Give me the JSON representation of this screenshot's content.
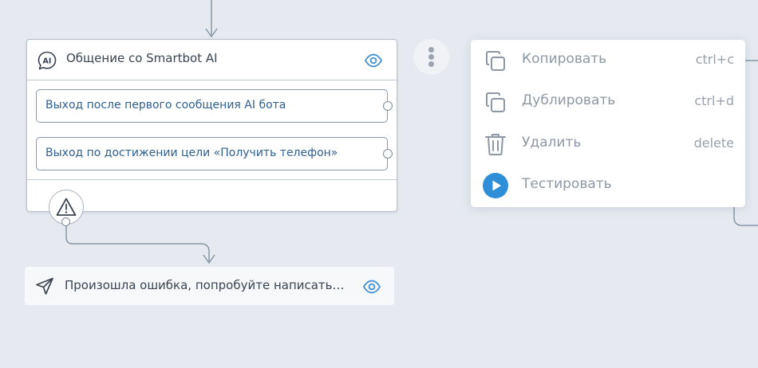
{
  "ai_node": {
    "title": "Общение со Smartbot AI",
    "icon": "ai-chat-icon",
    "exits": [
      {
        "label": "Выход после первого сообщения AI бота"
      },
      {
        "label": "Выход по достижении цели «Получить телефон»"
      }
    ]
  },
  "message_node": {
    "title": "Произошла ошибка, попробуйте написать…",
    "icon": "send-icon"
  },
  "context_menu": {
    "items": [
      {
        "label": "Копировать",
        "shortcut": "ctrl+c",
        "icon": "copy-icon"
      },
      {
        "label": "Дублировать",
        "shortcut": "ctrl+d",
        "icon": "duplicate-icon"
      },
      {
        "label": "Удалить",
        "shortcut": "delete",
        "icon": "trash-icon"
      },
      {
        "label": "Тестировать",
        "shortcut": "",
        "icon": "play-icon"
      }
    ]
  },
  "colors": {
    "canvas": "#e6eaf0",
    "accent": "#2e8fd8",
    "exit_text": "#2f5f91",
    "connector": "#8796a6"
  }
}
